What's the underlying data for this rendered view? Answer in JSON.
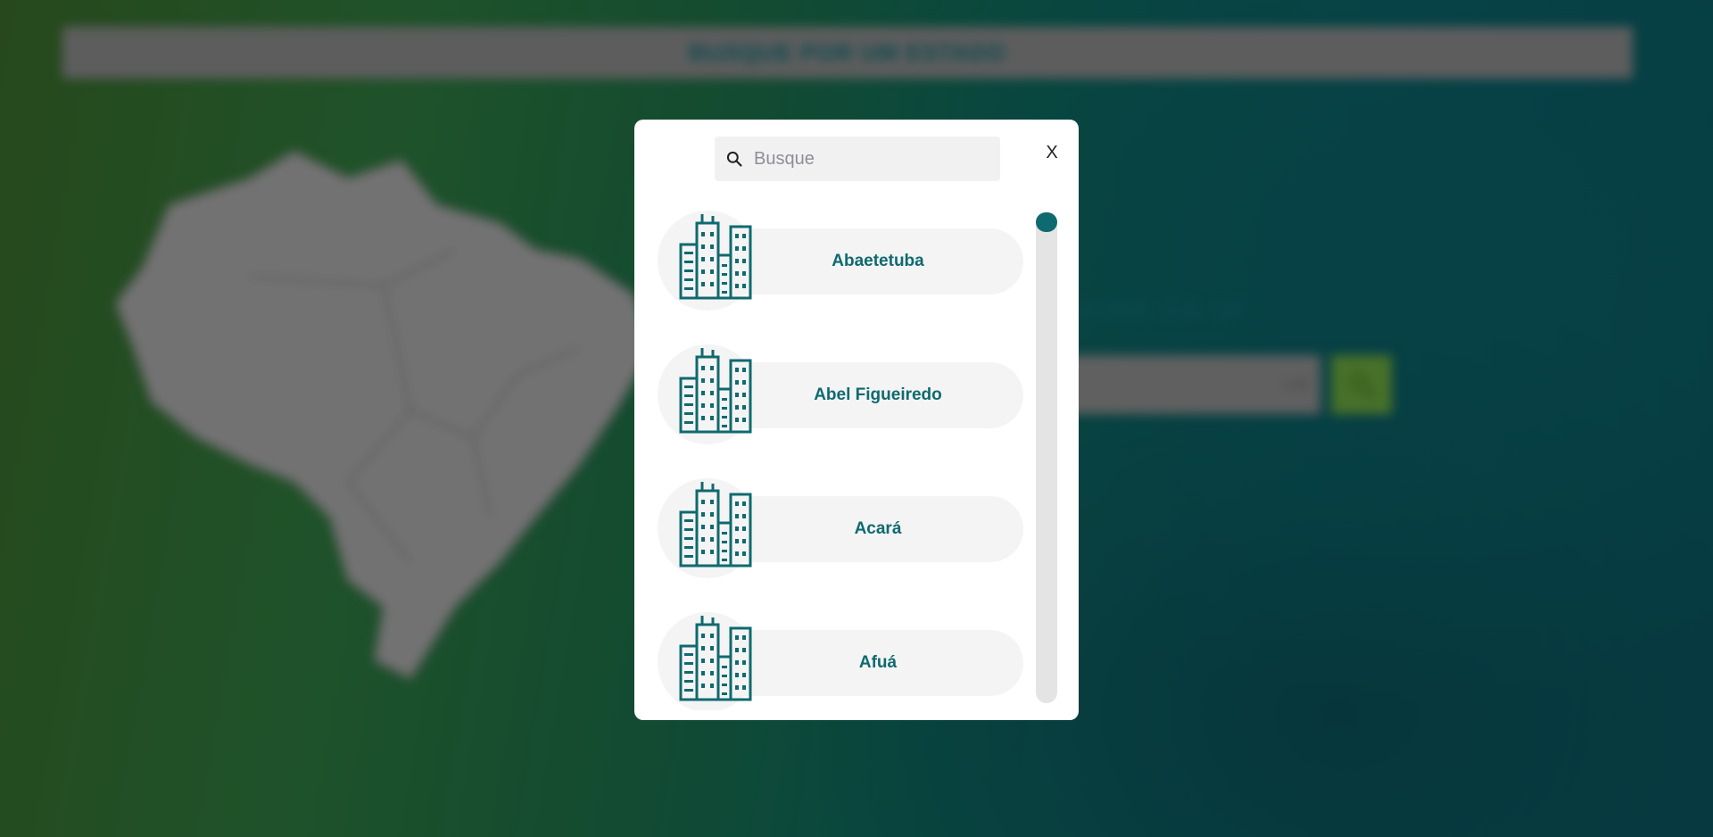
{
  "background": {
    "banner_title": "BUSQUE POR UM ESTADO",
    "uf_label": "NOME DA UF",
    "select_arrows": "× ▾"
  },
  "modal": {
    "search": {
      "placeholder": "Busque",
      "value": ""
    },
    "close_label": "X",
    "cities": [
      {
        "name": "Abaetetuba"
      },
      {
        "name": "Abel Figueiredo"
      },
      {
        "name": "Acará"
      },
      {
        "name": "Afuá"
      }
    ],
    "scroll": {
      "position_fraction": 0.0
    }
  },
  "colors": {
    "accent": "#0f6a6f",
    "item_bg": "#f4f4f5",
    "search_bg": "#f1f1f2",
    "modal_bg": "#ffffff"
  },
  "icons": {
    "city": "building-icon",
    "search": "search-icon",
    "close": "close-icon"
  }
}
